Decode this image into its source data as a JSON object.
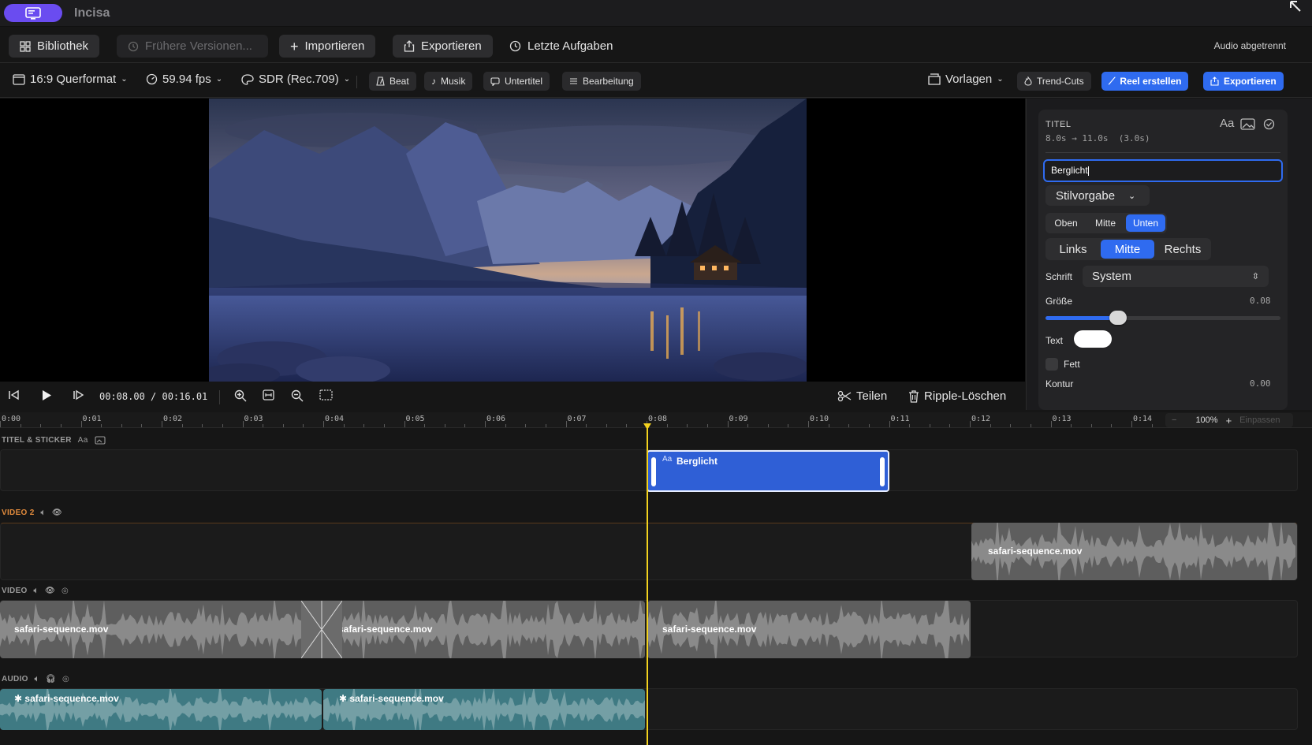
{
  "app": {
    "title": "Incisa"
  },
  "toolbar": {
    "library": "Bibliothek",
    "versions": "Frühere Versionen...",
    "import": "Importieren",
    "export": "Exportieren",
    "recent_tasks": "Letzte Aufgaben",
    "audio_status": "Audio abgetrennt"
  },
  "format_bar": {
    "aspect": "16:9 Querformat",
    "fps": "59.94 fps",
    "color": "SDR (Rec.709)",
    "chips": [
      "Beat",
      "Musik",
      "Untertitel",
      "Bearbeitung"
    ],
    "templates": "Vorlagen",
    "trend_cuts": "Trend-Cuts",
    "create_reel": "Reel erstellen",
    "export": "Exportieren"
  },
  "inspector": {
    "section": "TITEL",
    "range": "8.0s → 11.0s  (3.0s)",
    "text_value": "Berglicht",
    "style_preset": "Stilvorgabe",
    "vertical": [
      "Oben",
      "Mitte",
      "Unten"
    ],
    "vertical_active": 2,
    "horizontal": [
      "Links",
      "Mitte",
      "Rechts"
    ],
    "horizontal_active": 1,
    "font_label": "Schrift",
    "font_value": "System",
    "size_label": "Größe",
    "size_value": "0.08",
    "size_level": 0.31,
    "text_color_label": "Text",
    "text_color": "#ffffff",
    "bold_label": "Fett",
    "outline_label": "Kontur",
    "outline_value": "0.00"
  },
  "transport": {
    "timecode": "00:08.00 / 00:16.01",
    "split": "Teilen",
    "ripple_delete": "Ripple-Löschen"
  },
  "timeline": {
    "ruler": [
      "0:00",
      "0:01",
      "0:02",
      "0:03",
      "0:04",
      "0:05",
      "0:06",
      "0:07",
      "0:08",
      "0:09",
      "0:10",
      "0:11",
      "0:12",
      "0:13",
      "0:14"
    ],
    "zoom": "100%",
    "fit": "Einpassen",
    "playhead_seconds": 8.0,
    "tracks": {
      "titles": "TITEL & STICKER",
      "video2": "VIDEO 2",
      "video": "VIDEO",
      "audio": "AUDIO"
    },
    "title_clip": {
      "prefix": "Aa",
      "name": "Berglicht"
    },
    "video2_clip": "safari-sequence.mov",
    "video_clips": [
      "safari-sequence.mov",
      "safari-sequence.mov",
      "safari-sequence.mov"
    ],
    "audio_clips": [
      "safari-sequence.mov",
      "safari-sequence.mov"
    ]
  },
  "colors": {
    "accent": "#2f6bf0",
    "app_pill": "#6a4cf0",
    "playhead": "#f3d21e",
    "video2_label": "#e08a3c",
    "audio_clip": "#3f7a83",
    "video_clip": "#5e5e5e"
  }
}
